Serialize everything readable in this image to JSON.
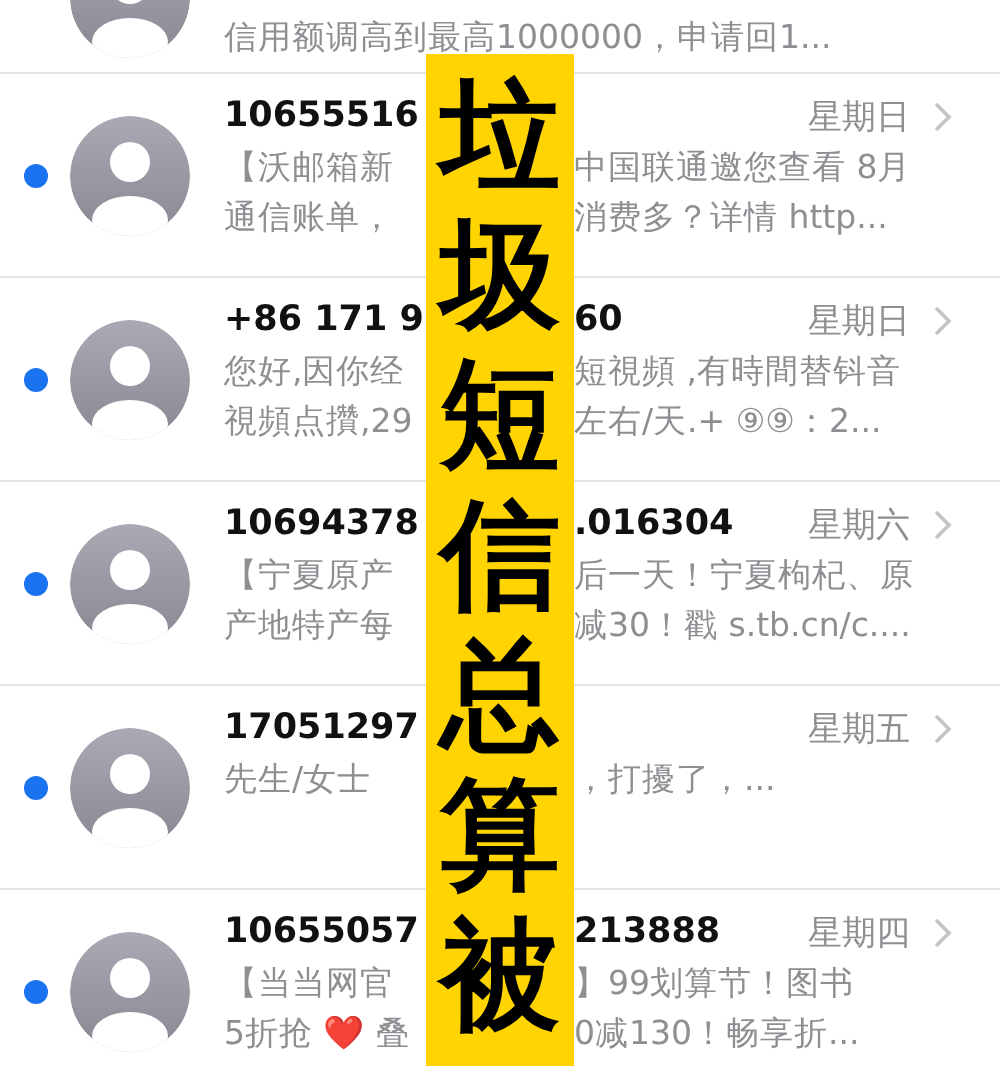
{
  "partial_row": {
    "preview": [
      "信用额调高到最高1000000，申请回1..."
    ]
  },
  "messages": [
    {
      "sender": [
        "10655516"
      ],
      "date": "星期日",
      "unread": true,
      "preview": [
        [
          "【沃邮箱新",
          "中国联通邀您查看 8月"
        ],
        [
          "通信账单，",
          "消费多？详情 http..."
        ]
      ]
    },
    {
      "sender": [
        "+86 171 9",
        "60"
      ],
      "date": "星期日",
      "unread": true,
      "preview": [
        [
          "您好,因你经",
          "短視頻 ,有時間替钭音"
        ],
        [
          "視頻点攢,29",
          "左右/天.+ ⑨⑨：2..."
        ]
      ]
    },
    {
      "sender": [
        "10694378",
        ".016304"
      ],
      "date": "星期六",
      "unread": true,
      "preview": [
        [
          "【宁夏原产",
          "后一天！宁夏枸杞、原"
        ],
        [
          "产地特产每",
          "减30！戳 s.tb.cn/c...."
        ]
      ]
    },
    {
      "sender": [
        "17051297"
      ],
      "date": "星期五",
      "unread": true,
      "preview": [
        [
          "先生/女士",
          "，打擾了，..."
        ]
      ]
    },
    {
      "sender": [
        "10655057",
        "213888"
      ],
      "date": "星期四",
      "unread": true,
      "preview": [
        [
          "【当当网官",
          "】99划算节！图书"
        ],
        [
          "5折抢 ❤️ 叠",
          "0减130！畅享折..."
        ]
      ]
    }
  ],
  "banner": {
    "text": "垃圾短信总算被"
  }
}
